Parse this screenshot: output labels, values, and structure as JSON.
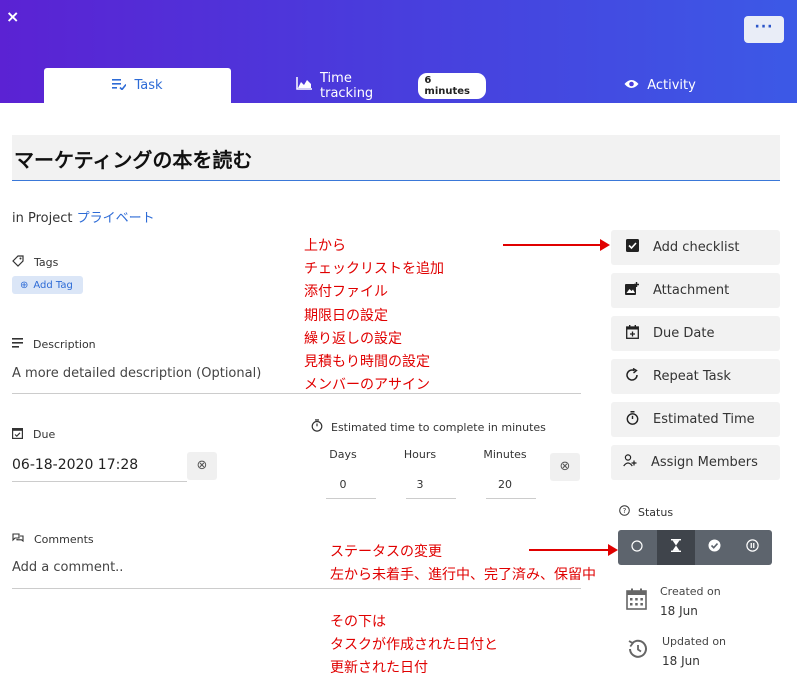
{
  "header": {
    "close_icon": "×",
    "more_label": "···",
    "tabs": [
      {
        "label": "Task",
        "icon": "task-list-icon"
      },
      {
        "label": "Time tracking",
        "icon": "chart-area-icon",
        "badge": "6 minutes"
      },
      {
        "label": "Activity",
        "icon": "eye-icon"
      }
    ]
  },
  "task": {
    "title": "マーケティングの本を読む",
    "project_prefix": "in Project",
    "project_name": "プライベート"
  },
  "tags": {
    "label": "Tags",
    "add_label": "Add Tag"
  },
  "description": {
    "label": "Description",
    "placeholder": "A more detailed description (Optional)"
  },
  "due": {
    "label": "Due",
    "value": "06-18-2020 17:28"
  },
  "estimate": {
    "label": "Estimated time to complete in minutes",
    "days_label": "Days",
    "days": "0",
    "hours_label": "Hours",
    "hours": "3",
    "minutes_label": "Minutes",
    "minutes": "20"
  },
  "comments": {
    "label": "Comments",
    "placeholder": "Add a comment.."
  },
  "sidebar": {
    "buttons": [
      {
        "label": "Add checklist",
        "icon": "checkbox-icon"
      },
      {
        "label": "Attachment",
        "icon": "image-add-icon"
      },
      {
        "label": "Due Date",
        "icon": "calendar-add-icon"
      },
      {
        "label": "Repeat Task",
        "icon": "repeat-icon"
      },
      {
        "label": "Estimated Time",
        "icon": "stopwatch-icon"
      },
      {
        "label": "Assign Members",
        "icon": "user-add-icon"
      }
    ],
    "status_label": "Status",
    "created_label": "Created on",
    "created_value": "18 Jun",
    "updated_label": "Updated on",
    "updated_value": "18 Jun"
  },
  "annotations": {
    "note1": "上から\nチェックリストを追加\n添付ファイル\n期限日の設定\n繰り返しの設定\n見積もり時間の設定\nメンバーのアサイン",
    "note2": "ステータスの変更\n左から未着手、進行中、完了済み、保留中",
    "note3": "その下は\nタスクが作成された日付と\n更新された日付",
    "color": "#e00000"
  },
  "colors": {
    "accent": "#2d6bd6",
    "header_start": "#5b22d3",
    "header_end": "#3c59e6"
  }
}
